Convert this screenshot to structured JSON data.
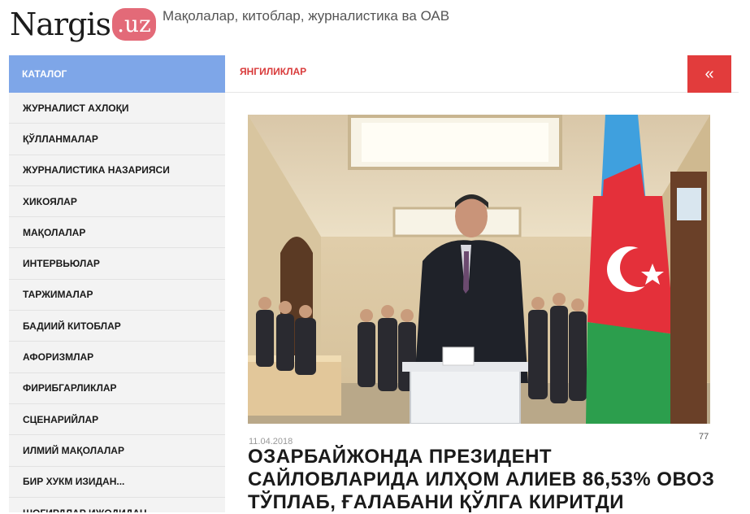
{
  "header": {
    "logo_main": "Nargis",
    "logo_tld": ".uz",
    "tagline": "Мақолалар, китоблар, журналистика ва ОАВ"
  },
  "sidebar": {
    "title": "КАТАЛОГ",
    "items": [
      {
        "label": "ЖУРНАЛИСТ АХЛОҚИ"
      },
      {
        "label": "ҚЎЛЛАНМАЛАР"
      },
      {
        "label": "ЖУРНАЛИСТИКА НАЗАРИЯСИ"
      },
      {
        "label": "ХИКОЯЛАР"
      },
      {
        "label": "МАҚОЛАЛАР"
      },
      {
        "label": "ИНТЕРВЬЮЛАР"
      },
      {
        "label": "ТАРЖИМАЛАР"
      },
      {
        "label": "БАДИИЙ КИТОБЛАР"
      },
      {
        "label": "АФОРИЗМЛАР"
      },
      {
        "label": "ФИРИБГАРЛИКЛАР"
      },
      {
        "label": "СЦЕНАРИЙЛАР"
      },
      {
        "label": "ИЛМИЙ МАҚОЛАЛАР"
      },
      {
        "label": "БИР ХУКМ ИЗИДАН..."
      },
      {
        "label": "ШОГИРДЛАР ИЖОДИДАН"
      }
    ]
  },
  "main": {
    "section_title": "ЯНГИЛИКЛАР",
    "collapse_glyph": "«",
    "article": {
      "date": "11.04.2018",
      "views": "77",
      "title": "ОЗАРБАЙЖОНДА ПРЕЗИДЕНТ САЙЛОВЛАРИДА ИЛҲОМ АЛИЕВ 86,53% ОВОЗ ТЎПЛАБ, ҒАЛАБАНИ ҚЎЛГА КИРИТДИ"
    }
  },
  "colors": {
    "sidebar_head": "#7ea6e8",
    "accent_red": "#e23c3c",
    "logo_pill": "#e36a78"
  }
}
